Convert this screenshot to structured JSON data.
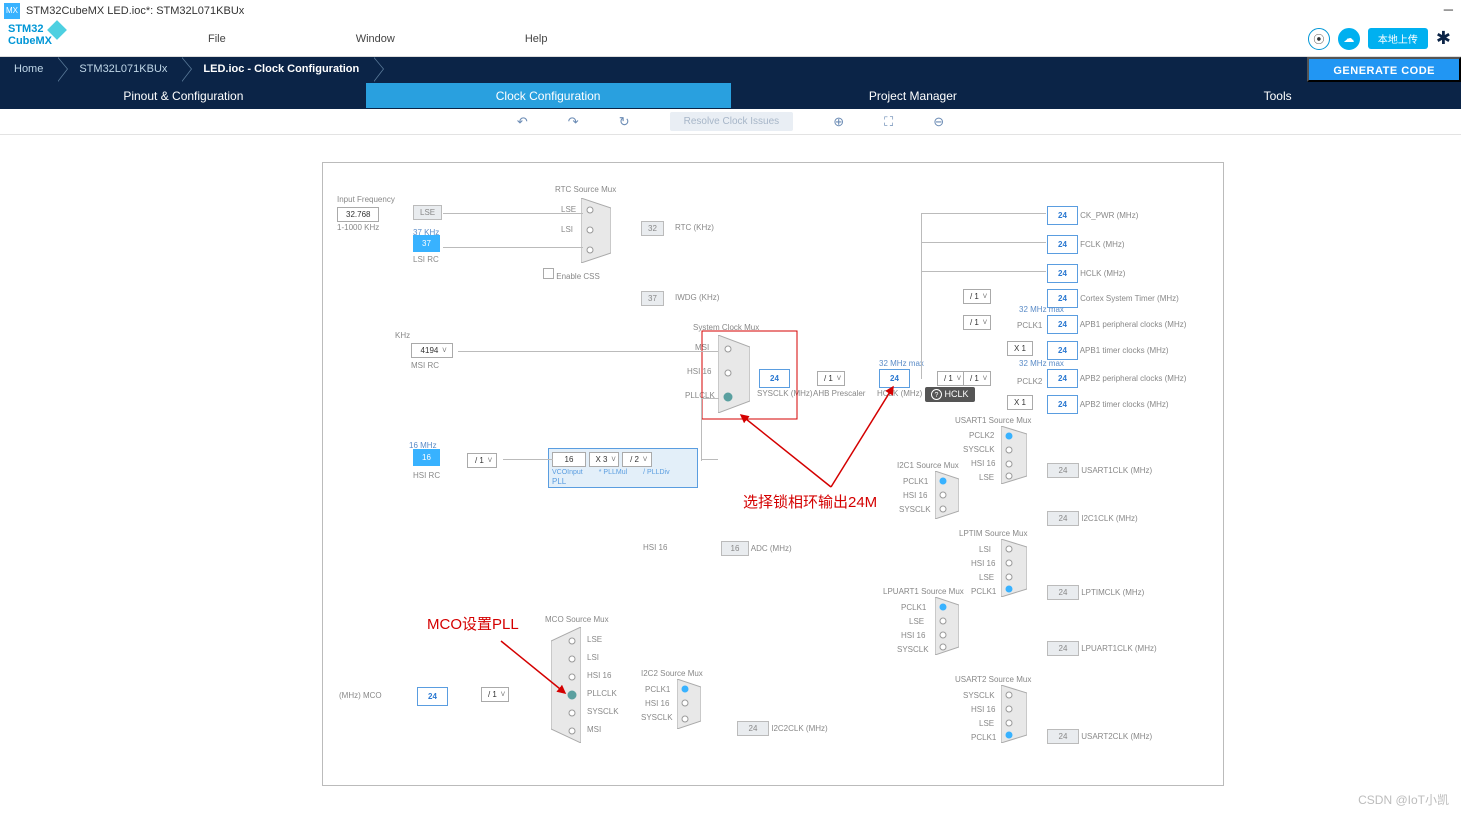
{
  "window": {
    "title": "STM32CubeMX LED.ioc*: STM32L071KBUx",
    "min": "─"
  },
  "menu": {
    "file": "File",
    "window": "Window",
    "help": "Help"
  },
  "logo": {
    "l1": "STM32",
    "l2": "CubeMX"
  },
  "upload": "本地上传",
  "breadcrumb": {
    "home": "Home",
    "mcu": "STM32L071KBUx",
    "file": "LED.ioc - Clock Configuration"
  },
  "generate": "GENERATE CODE",
  "tabs": {
    "pinout": "Pinout & Configuration",
    "clock": "Clock Configuration",
    "project": "Project Manager",
    "tools": "Tools"
  },
  "toolbar": {
    "undo": "↶",
    "redo": "↷",
    "refresh": "↻",
    "resolve": "Resolve Clock Issues",
    "zoomin": "⊕",
    "fit": "⛶",
    "zoomout": "⊖"
  },
  "annotations": {
    "pll": "选择锁相环输出24M",
    "mco": "MCO设置PLL"
  },
  "clk": {
    "input_freq": "Input Frequency",
    "v32768": "32.768",
    "range_lse": "1-1000 KHz",
    "lse": "LSE",
    "lsi": "LSI RC",
    "lsi_f": "37 KHz",
    "v37": "37",
    "rtc_mux": "RTC Source Mux",
    "lse_l": "LSE",
    "lsi_l": "LSI",
    "enable_css": "Enable CSS",
    "rtc_out": "RTC (KHz)",
    "v3_2": "32",
    "iwdg": "IWDG (KHz)",
    "v37b": "37",
    "msi": "MSI RC",
    "khz": "KHz",
    "v4194": "4194",
    "hsi": "HSI RC",
    "hsi_f": "16 MHz",
    "v16": "16",
    "div1": "/ 1",
    "sys_mux": "System Clock Mux",
    "msi_l": "MSI",
    "hsi16": "HSI 16",
    "pllclk": "PLLCLK",
    "sysclk": "SYSCLK (MHz)",
    "v24": "24",
    "ahb": "AHB Prescaler",
    "hclk": "HCLK (MHz)",
    "max32": "32 MHz max",
    "ck_pwr": "CK_PWR (MHz)",
    "fclk": "FCLK (MHz)",
    "hclk2": "HCLK (MHz)",
    "ctm": "Cortex System Timer (MHz)",
    "apb1": "APB1 peripheral clocks (MHz)",
    "apb1t": "APB1 timer clocks (MHz)",
    "apb2": "APB2 peripheral clocks (MHz)",
    "apb2t": "APB2 timer clocks (MHz)",
    "x1": "X 1",
    "pclk1": "PCLK1",
    "pclk2": "PCLK2",
    "pll": "PLL",
    "vcoin": "VCOInput",
    "pllmul": "* PLLMul",
    "plldiv": "/ PLLDiv",
    "x3": "X 3",
    "d2": "/ 2",
    "adc": "ADC (MHz)",
    "v16a": "16",
    "usart1_mux": "USART1 Source Mux",
    "usart1": "USART1CLK (MHz)",
    "i2c1_mux": "I2C1 Source Mux",
    "i2c1": "I2C1CLK (MHz)",
    "lptim_mux": "LPTIM Source Mux",
    "lptim": "LPTIMCLK (MHz)",
    "lpuart_mux": "LPUART1 Source Mux",
    "lpuart": "LPUART1CLK (MHz)",
    "usart2_mux": "USART2 Source Mux",
    "usart2": "USART2CLK (MHz)",
    "i2c2_mux": "I2C2 Source Mux",
    "i2c2": "I2C2CLK (MHz)",
    "mco_mux": "MCO Source Mux",
    "mco": "(MHz) MCO",
    "sysclk_l": "SYSCLK",
    "msi_s": "MSI",
    "tooltip": "HCLK"
  }
}
